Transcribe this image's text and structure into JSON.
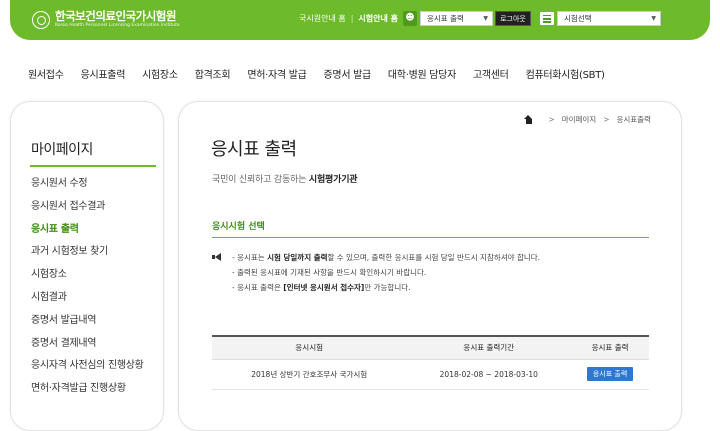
{
  "header": {
    "logo_title": "한국보건의료인국가시험원",
    "logo_subtitle": "Korea Health Personnel Licensing Examination Institute",
    "links": [
      "국시원안내 홈",
      "시험안내 홈"
    ],
    "link_separator": "|",
    "service_select": "응시표 출력",
    "logout_label": "로그아웃",
    "exam_select": "시험선택"
  },
  "nav": {
    "items": [
      "원서접수",
      "응시표출력",
      "시험장소",
      "합격조회",
      "면허·자격 발급",
      "증명서 발급",
      "대학·병원 담당자",
      "고객센터",
      "컴퓨터화시험(SBT)"
    ]
  },
  "sidebar": {
    "title": "마이페이지",
    "items": [
      {
        "label": "응시원서 수정"
      },
      {
        "label": "응시원서 접수결과"
      },
      {
        "label": "응시표 출력",
        "active": true
      },
      {
        "label": "과거 시험정보 찾기"
      },
      {
        "label": "시험장소"
      },
      {
        "label": "시험결과"
      },
      {
        "label": "증명서 발급내역"
      },
      {
        "label": "증명서 결제내역"
      },
      {
        "label": "응시자격 사전심의 진행상황"
      },
      {
        "label": "면허·자격발급 진행상황"
      }
    ]
  },
  "breadcrumb": {
    "items": [
      "마이페이지",
      "응시표출력"
    ],
    "separator": ">"
  },
  "main": {
    "title": "응시표 출력",
    "subtitle_prefix": "국민이 신뢰하고 감동하는 ",
    "subtitle_bold": "시험평가기관",
    "section_title": "응시시험 선택",
    "notice": {
      "line1_a": "- 응시표는 ",
      "line1_bold": "시험 당일까지 출력",
      "line1_b": "할 수 있으며, 출력한 응시표를 시험 당일 반드시 지참하셔야 합니다.",
      "line2": "- 출력된 응시표에 기재된 사항을 반드시 확인하시기 바랍니다.",
      "line3_a": "- 응시표 출력은 ",
      "line3_bold": "[인터넷 응시원서 접수자]",
      "line3_b": "만 가능합니다."
    },
    "table": {
      "headers": [
        "응시시험",
        "응시표 출력기간",
        "응시표 출력"
      ],
      "rows": [
        {
          "exam": "2018년 상반기 간호조무사 국가시험",
          "period": "2018-02-08 ~ 2018-03-10",
          "button": "응시표 출력"
        }
      ]
    }
  },
  "colors": {
    "brand_green": "#6dbb2a",
    "active_green": "#3f8f10",
    "button_blue": "#2f78d2"
  }
}
